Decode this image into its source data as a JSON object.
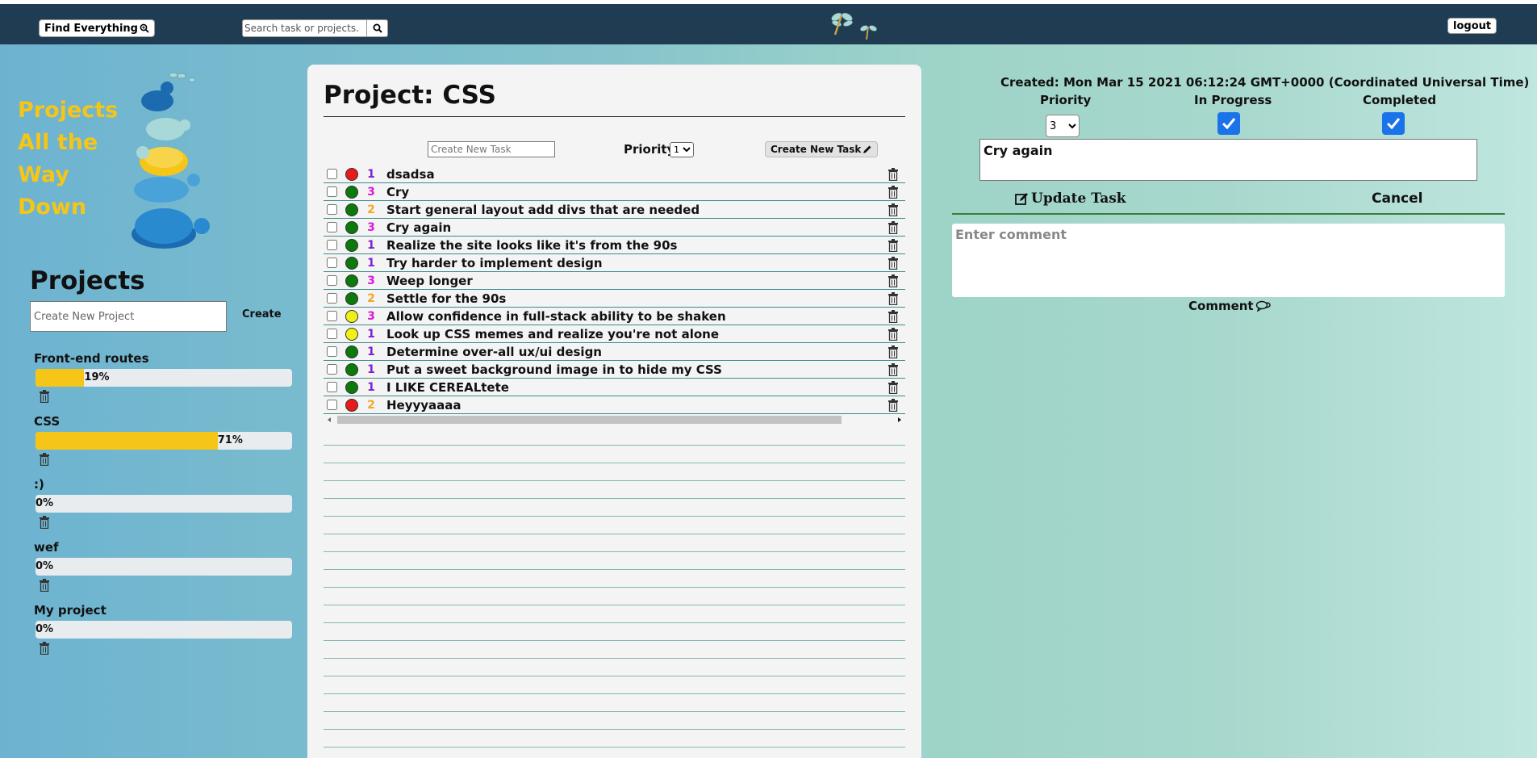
{
  "header": {
    "find_everything_label": "Find Everything",
    "search_placeholder": "Search task or projects.",
    "logout_label": "logout"
  },
  "sidebar": {
    "brand_title": "Projects All the Way Down",
    "projects_title": "Projects",
    "new_project_placeholder": "Create New Project",
    "create_label": "Create",
    "projects": [
      {
        "name": "Front-end routes",
        "progress": 0.19,
        "percent_label": "19%"
      },
      {
        "name": "CSS",
        "progress": 0.71,
        "percent_label": "71%"
      },
      {
        "name": ":)",
        "progress": 0,
        "percent_label": "0%"
      },
      {
        "name": "wef",
        "progress": 0,
        "percent_label": "0%"
      },
      {
        "name": "My project",
        "progress": 0,
        "percent_label": "0%"
      }
    ]
  },
  "main": {
    "project_title": "Project: CSS",
    "new_task_placeholder": "Create New Task",
    "priority_label": "Priority",
    "priority_value": "1",
    "create_task_label": "Create New Task",
    "tasks": [
      {
        "name": "dsadsa",
        "priority": "1",
        "status": "red"
      },
      {
        "name": "Cry",
        "priority": "3",
        "status": "green"
      },
      {
        "name": "Start general layout add divs that are needed",
        "priority": "2",
        "status": "green"
      },
      {
        "name": "Cry again",
        "priority": "3",
        "status": "green"
      },
      {
        "name": "Realize the site looks like it's from the 90s",
        "priority": "1",
        "status": "green"
      },
      {
        "name": "Try harder to implement design",
        "priority": "1",
        "status": "green"
      },
      {
        "name": "Weep longer",
        "priority": "3",
        "status": "green"
      },
      {
        "name": "Settle for the 90s",
        "priority": "2",
        "status": "green"
      },
      {
        "name": "Allow confidence in full-stack ability to be shaken",
        "priority": "3",
        "status": "yellow"
      },
      {
        "name": "Look up CSS memes and realize you're not alone",
        "priority": "1",
        "status": "yellow"
      },
      {
        "name": "Determine over-all ux/ui design",
        "priority": "1",
        "status": "green"
      },
      {
        "name": "Put a sweet background image in to hide my CSS",
        "priority": "1",
        "status": "green"
      },
      {
        "name": "I LIKE CEREALtete",
        "priority": "1",
        "status": "green"
      },
      {
        "name": "Heyyyaaaa",
        "priority": "2",
        "status": "red"
      }
    ]
  },
  "detail": {
    "created_text": "Created: Mon Mar 15 2021 06:12:24 GMT+0000 (Coordinated Universal Time)",
    "priority_label": "Priority",
    "in_progress_label": "In Progress",
    "completed_label": "Completed",
    "priority_value": "3",
    "in_progress": true,
    "completed": true,
    "task_text": "Cry again",
    "update_label": "Update Task",
    "cancel_label": "Cancel",
    "comment_placeholder": "Enter comment",
    "comment_label": "Comment"
  },
  "colors": {
    "header_bg": "#203c52",
    "accent_yellow": "#f5c518",
    "status_red": "#e81b1b",
    "status_green": "#0a7a0a",
    "status_yellow": "#f0f016",
    "priority_1": "#7b22d8",
    "priority_2": "#f5a623",
    "priority_3": "#d81bd8",
    "checkbox_blue": "#1a73e8"
  },
  "icons": {
    "find": "magnifier-icon",
    "search": "search-icon",
    "logo": "dragonfly-icon",
    "trash": "trash-icon",
    "create_task": "pencil-icon",
    "update": "edit-icon",
    "comment": "speech-bubble-icon"
  }
}
